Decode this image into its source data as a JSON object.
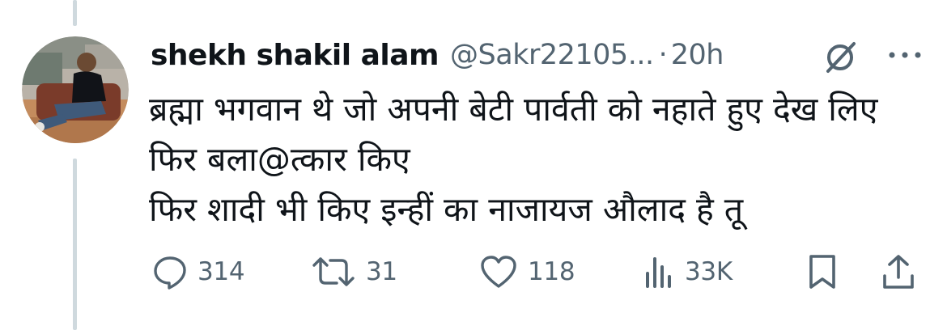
{
  "tweet": {
    "display_name": "shekh shakil alam",
    "handle": "@Sakr22105...",
    "separator": "·",
    "time": "20h",
    "lines": [
      "ब्रह्मा भगवान थे जो अपनी बेटी पार्वती को नहाते हुए देख लिए",
      "फिर बला@त्कार किए",
      "फिर शादी भी किए इन्हीं का नाजायज औलाद है तू"
    ]
  },
  "actions": {
    "replies": "314",
    "reposts": "31",
    "likes": "118",
    "views": "33K"
  },
  "icons": {
    "header": [
      "grok-icon",
      "more-icon"
    ],
    "actions": [
      "reply-icon",
      "repost-icon",
      "like-icon",
      "views-icon",
      "bookmark-icon",
      "share-icon"
    ]
  },
  "colors": {
    "text_primary": "#0f1419",
    "text_secondary": "#536471",
    "thread_line": "#cfd9de"
  }
}
